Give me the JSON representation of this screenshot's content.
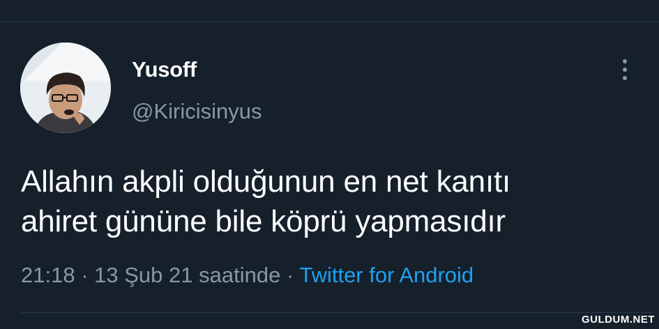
{
  "tweet": {
    "display_name": "Yusoff",
    "handle": "@Kiricisinyus",
    "text_line1": "Allahın akpli olduğunun en net kanıtı",
    "text_line2": "ahiret gününe bile köprü yapmasıdır",
    "time": "21:18",
    "date": "13 Şub 21 saatinde",
    "separator": "·",
    "source": "Twitter for Android"
  },
  "icons": {
    "more": "more-vertical-icon",
    "avatar": "profile-avatar"
  },
  "watermark": "GULDUM.NET",
  "colors": {
    "background": "#15202b",
    "primary_text": "#ffffff",
    "secondary_text": "#8899a6",
    "link": "#1da1f2"
  }
}
